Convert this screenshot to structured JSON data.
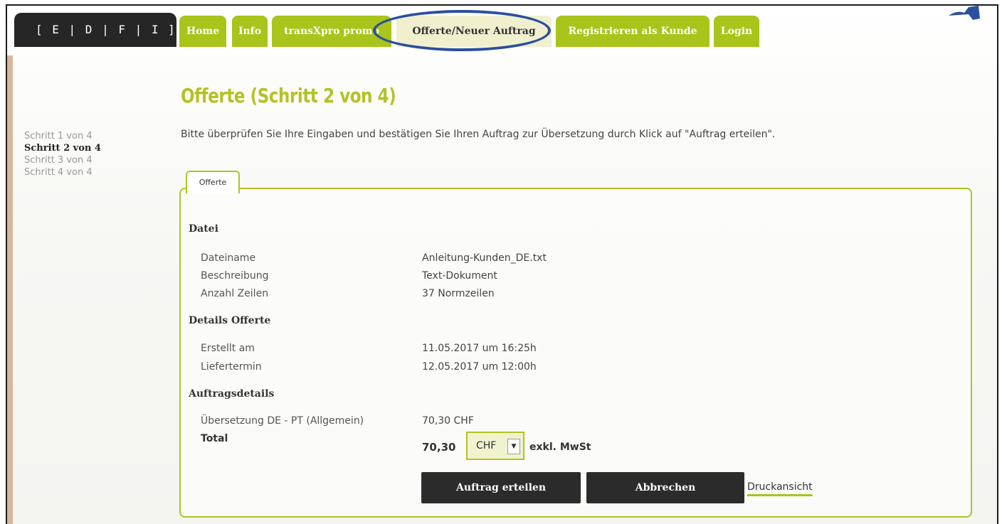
{
  "logo": {
    "text": "[ E | D | F | I ]"
  },
  "nav": {
    "home": "Home",
    "info": "Info",
    "promo": "transXpro promo",
    "offer": "Offerte/Neuer Auftrag",
    "register": "Registrieren als Kunde",
    "login": "Login"
  },
  "steps": [
    "Schritt 1 von 4",
    "Schritt 2 von 4",
    "Schritt 3 von 4",
    "Schritt 4 von 4"
  ],
  "page": {
    "title": "Offerte (Schritt 2 von 4)",
    "intro": "Bitte überprüfen Sie Ihre Eingaben und bestätigen Sie Ihren Auftrag zur Übersetzung durch Klick auf \"Auftrag erteilen\"."
  },
  "panel": {
    "tab": "Offerte",
    "file": {
      "heading": "Datei",
      "rows": [
        {
          "label": "Dateiname",
          "value": "Anleitung-Kunden_DE.txt"
        },
        {
          "label": "Beschreibung",
          "value": "Text-Dokument"
        },
        {
          "label": "Anzahl Zeilen",
          "value": "37 Normzeilen"
        }
      ]
    },
    "details": {
      "heading": "Details Offerte",
      "rows": [
        {
          "label": "Erstellt am",
          "value": "11.05.2017 um 16:25h"
        },
        {
          "label": "Liefertermin",
          "value": "12.05.2017 um 12:00h"
        }
      ]
    },
    "order": {
      "heading": "Auftragsdetails",
      "line_label": "Übersetzung DE - PT (Allgemein)",
      "line_value": "70,30 CHF",
      "total_label": "Total",
      "total_value": "70,30",
      "currency": "CHF",
      "tax_note": "exkl. MwSt"
    },
    "buttons": {
      "submit": "Auftrag erteilen",
      "cancel": "Abbrechen",
      "print": "Druckansicht"
    }
  },
  "colors": {
    "accent": "#a9c41a",
    "title": "#b2c422",
    "dark": "#262626",
    "highlight": "#2b4f9e"
  }
}
